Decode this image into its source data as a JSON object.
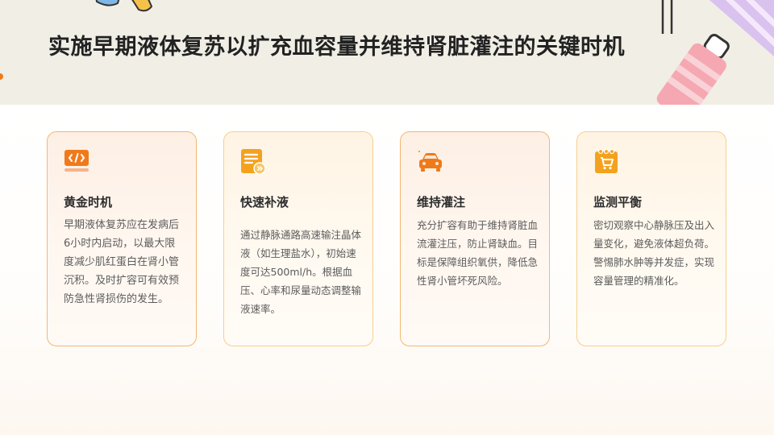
{
  "slide": {
    "title": "实施早期液体复苏以扩充血容量并维持肾脏灌注的关键时机"
  },
  "colors": {
    "accent_orange": "#f07a1a",
    "accent_amber": "#f4a21e",
    "header_bg": "#f1eee6",
    "card_border": "#f2b872"
  },
  "cards": [
    {
      "icon": "code-tag-icon",
      "title": "黄金时机",
      "text": "早期液体复苏应在发病后6小时内启动，以最大限度减少肌红蛋白在肾小管沉积。及时扩容可有效预防急性肾损伤的发生。"
    },
    {
      "icon": "document-forward-icon",
      "title": "快速补液",
      "text": "通过静脉通路高速输注晶体液（如生理盐水），初始速度可达500ml/h。根据血压、心率和尿量动态调整输液速率。"
    },
    {
      "icon": "car-icon",
      "title": "维持灌注",
      "text": "充分扩容有助于维持肾脏血流灌注压，防止肾缺血。目标是保障组织氧供，降低急性肾小管坏死风险。"
    },
    {
      "icon": "shopping-cart-note-icon",
      "title": "监测平衡",
      "text": "密切观察中心静脉压及出入量变化，避免液体超负荷。警惕肺水肿等并发症，实现容量管理的精准化。"
    }
  ]
}
